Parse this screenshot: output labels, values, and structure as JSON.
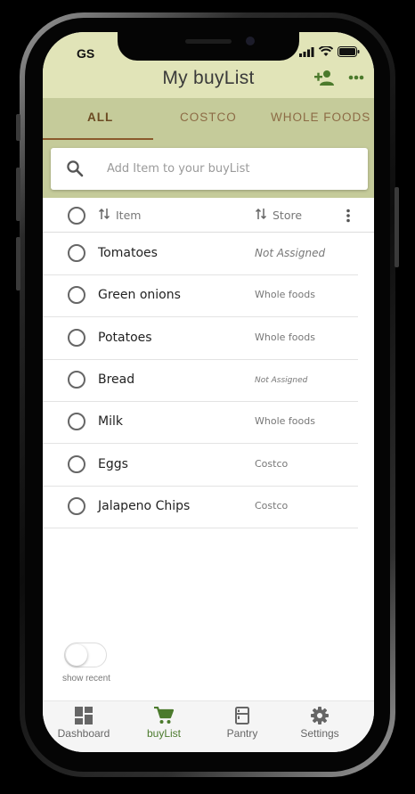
{
  "status_bar": {
    "carrier": "GS"
  },
  "header": {
    "title": "My buyList"
  },
  "colors": {
    "header_bg": "#e1e4b8",
    "tab_bg": "#c5cb9a",
    "accent": "#4b7a2c",
    "tab_active": "#6b4a22"
  },
  "tabs": [
    {
      "label": "ALL",
      "active": true
    },
    {
      "label": "COSTCO",
      "active": false
    },
    {
      "label": "WHOLE FOODS",
      "active": false
    }
  ],
  "search": {
    "placeholder": "Add Item to your buyList",
    "value": ""
  },
  "list_header": {
    "item_label": "Item",
    "store_label": "Store"
  },
  "items": [
    {
      "name": "Tomatoes",
      "store": "Not Assigned"
    },
    {
      "name": "Green onions",
      "store": "Whole foods"
    },
    {
      "name": "Potatoes",
      "store": "Whole foods"
    },
    {
      "name": "Bread",
      "store": "Not Assigned"
    },
    {
      "name": "Milk",
      "store": "Whole foods"
    },
    {
      "name": "Eggs",
      "store": "Costco"
    },
    {
      "name": "Jalapeno Chips",
      "store": "Costco"
    }
  ],
  "toggle": {
    "label": "show recent",
    "on": false
  },
  "bottom_nav": [
    {
      "label": "Dashboard",
      "icon": "dashboard-icon",
      "active": false
    },
    {
      "label": "buyList",
      "icon": "cart-icon",
      "active": true
    },
    {
      "label": "Pantry",
      "icon": "fridge-icon",
      "active": false
    },
    {
      "label": "Settings",
      "icon": "gear-icon",
      "active": false
    }
  ]
}
